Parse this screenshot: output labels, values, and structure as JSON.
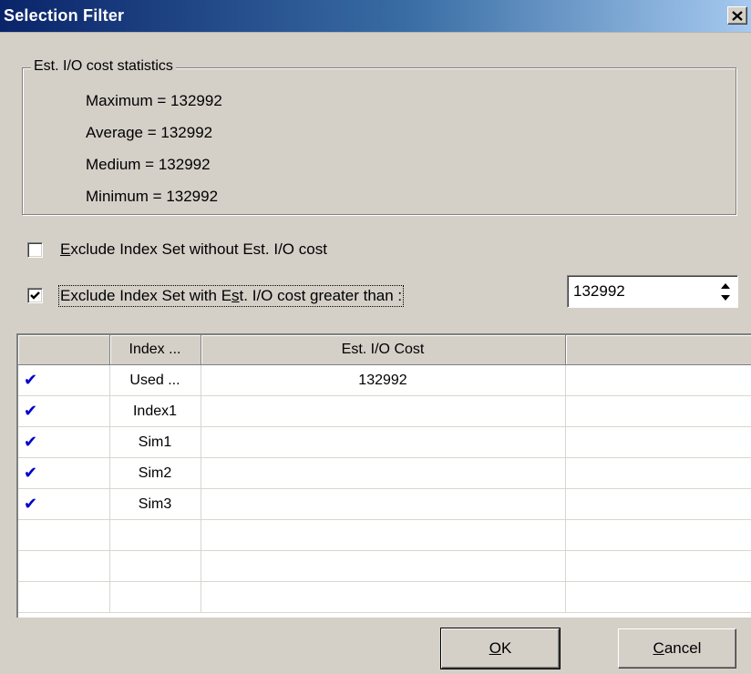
{
  "window": {
    "title": "Selection Filter"
  },
  "stats": {
    "legend": "Est. I/O cost statistics",
    "maximum": "Maximum = 132992",
    "average": "Average = 132992",
    "medium": "Medium = 132992",
    "minimum": "Minimum = 132992"
  },
  "options": {
    "exclude_without_cost": {
      "label_prefix": "",
      "label_mnemonic": "E",
      "label_suffix": "xclude Index Set without Est. I/O cost",
      "checked": false
    },
    "exclude_greater_than": {
      "label_prefix": "Exclude Index Set with E",
      "label_mnemonic": "s",
      "label_suffix": "t. I/O cost greater than :",
      "checked": true
    },
    "threshold_value": "132992"
  },
  "grid": {
    "columns": [
      "",
      "Index ...",
      "Est. I/O Cost",
      ""
    ],
    "rows": [
      {
        "checked": true,
        "name": "Used ...",
        "cost": "132992"
      },
      {
        "checked": true,
        "name": "Index1",
        "cost": ""
      },
      {
        "checked": true,
        "name": "Sim1",
        "cost": ""
      },
      {
        "checked": true,
        "name": "Sim2",
        "cost": ""
      },
      {
        "checked": true,
        "name": "Sim3",
        "cost": ""
      }
    ],
    "check_glyph": "✔"
  },
  "buttons": {
    "ok": {
      "mnemonic": "O",
      "rest": "K"
    },
    "cancel": {
      "mnemonic": "C",
      "rest": "ancel"
    }
  }
}
